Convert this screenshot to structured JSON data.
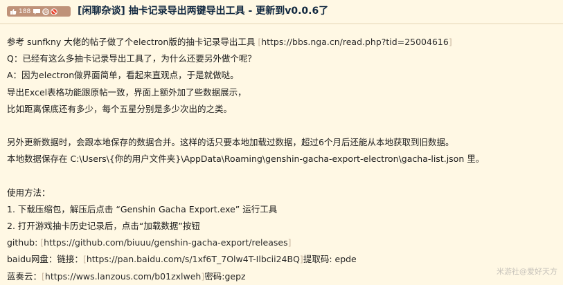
{
  "post": {
    "like_count": "188",
    "title": "[闲聊杂谈] 抽卡记录导出两键导出工具 - 更新到v0.0.6了"
  },
  "body": {
    "line1": {
      "text": "参考 sunfkny 大佬的帖子做了个electron版的抽卡记录导出工具 ",
      "link": "https://bbs.nga.cn/read.php?tid=25004616"
    },
    "line2": "Q：已经有这么多抽卡记录导出工具了，为什么还要另外做个呢？",
    "line3": "A：因为electron做界面简单，看起来直观点，于是就做哒。",
    "line4": "导出Excel表格功能跟原帖一致，界面上额外加了些数据展示，",
    "line5": "比如距离保底还有多少，每个五星分别是多少次出的之类。",
    "line6": "另外更新数据时，会跟本地保存的数据合并。这样的话只要本地加载过数据，超过6个月后还能从本地获取到旧数据。",
    "line7": "本地数据保存在 C:\\Users\\{你的用户文件夹}\\AppData\\Roaming\\genshin-gacha-export-electron\\gacha-list.json 里。",
    "line8": "使用方法：",
    "line9": "1. 下载压缩包，解压后点击 “Genshin Gacha Export.exe” 运行工具",
    "line10": "2. 打开游戏抽卡历史记录后，点击“加载数据”按钮",
    "github": {
      "label": "github: ",
      "link": "https://github.com/biuuu/genshin-gacha-export/releases"
    },
    "baidu": {
      "label": "baidu网盘：链接：",
      "link": "https://pan.baidu.com/s/1xf6T_7Olw4T-Ilbcii24BQ",
      "suffix": "提取码: epde"
    },
    "lanzou": {
      "label": "蓝奏云：",
      "link": "https://wws.lanzous.com/b01zxlweh",
      "suffix": "密码:gepz"
    }
  },
  "watermark": "米游社@爱好天方"
}
